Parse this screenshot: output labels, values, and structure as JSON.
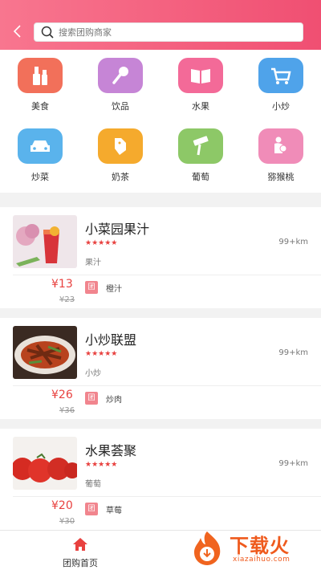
{
  "search": {
    "placeholder": "搜索团购商家"
  },
  "categories": [
    {
      "label": "美食",
      "icon": "cosmetics-icon",
      "color": "#f2705a"
    },
    {
      "label": "饮品",
      "icon": "microphone-icon",
      "color": "#c685d6"
    },
    {
      "label": "水果",
      "icon": "book-icon",
      "color": "#f36a98"
    },
    {
      "label": "小炒",
      "icon": "shopping-cart-icon",
      "color": "#4fa3ea"
    },
    {
      "label": "炒菜",
      "icon": "car-icon",
      "color": "#5ab3ec"
    },
    {
      "label": "奶茶",
      "icon": "dog-icon",
      "color": "#f5aa2d"
    },
    {
      "label": "葡萄",
      "icon": "paint-roller-icon",
      "color": "#8dc867"
    },
    {
      "label": "猕猴桃",
      "icon": "mother-baby-icon",
      "color": "#f08cb8"
    }
  ],
  "stores": [
    {
      "name": "小菜园果汁",
      "stars": "★★★★★",
      "category": "果汁",
      "distance": "99+km",
      "price": "¥13",
      "original_price": "¥23",
      "tag": "团",
      "item": "橙汁"
    },
    {
      "name": "小炒联盟",
      "stars": "★★★★★",
      "category": "小炒",
      "distance": "99+km",
      "price": "¥26",
      "original_price": "¥36",
      "tag": "团",
      "item": "炒肉"
    },
    {
      "name": "水果荟聚",
      "stars": "★★★★★",
      "category": "葡萄",
      "distance": "99+km",
      "price": "¥20",
      "original_price": "¥30",
      "tag": "团",
      "item": "草莓"
    }
  ],
  "tabbar": {
    "home_label": "团购首页",
    "active_color": "#e8413f"
  },
  "watermark": {
    "brand": "下载火",
    "url": "xiazaihuo.com"
  }
}
